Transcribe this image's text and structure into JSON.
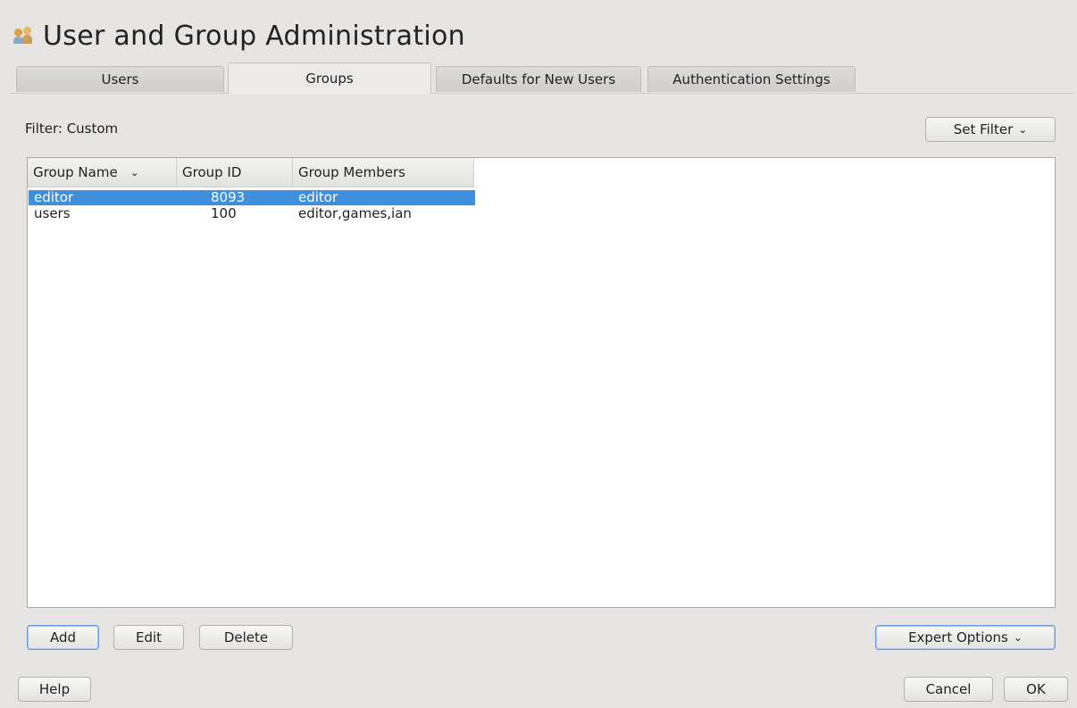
{
  "title": "User and Group Administration",
  "tabs": [
    {
      "label": "Users",
      "active": false
    },
    {
      "label": "Groups",
      "active": true
    },
    {
      "label": "Defaults for New Users",
      "active": false
    },
    {
      "label": "Authentication Settings",
      "active": false
    }
  ],
  "filter": {
    "label": "Filter: Custom",
    "set_filter_label": "Set Filter"
  },
  "table": {
    "columns": [
      "Group Name",
      "Group ID",
      "Group Members"
    ],
    "sorted_column": "Group Name",
    "rows": [
      {
        "name": "editor",
        "gid": "8093",
        "members": "editor",
        "selected": true
      },
      {
        "name": "users",
        "gid": "100",
        "members": "editor,games,ian",
        "selected": false
      }
    ]
  },
  "actions": {
    "add": "Add",
    "edit": "Edit",
    "delete": "Delete",
    "expert_options": "Expert Options"
  },
  "footer": {
    "help": "Help",
    "cancel": "Cancel",
    "ok": "OK"
  },
  "colors": {
    "selection": "#3f8fdc",
    "window_bg": "#e6e5e3"
  }
}
